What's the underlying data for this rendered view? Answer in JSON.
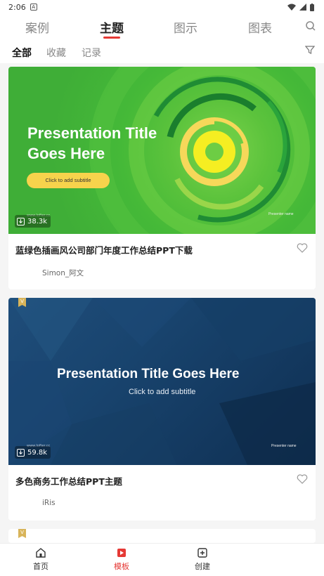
{
  "status": {
    "time": "2:06"
  },
  "top_tabs": [
    {
      "label": "案例"
    },
    {
      "label": "主题"
    },
    {
      "label": "图示"
    },
    {
      "label": "图表"
    }
  ],
  "sub_tabs": [
    {
      "label": "全部"
    },
    {
      "label": "收藏"
    },
    {
      "label": "记录"
    }
  ],
  "cards": [
    {
      "slide_title_line1": "Presentation Title",
      "slide_title_line2": "Goes Here",
      "slide_button": "Click to add subtitle",
      "presenter": "Presenter name",
      "watermark": "www.lofter.cc",
      "downloads": "38.3k",
      "title": "蓝绿色插画风公司部门年度工作总结PPT下载",
      "author": "Simon_阿文",
      "accent": "#45b938"
    },
    {
      "slide_title": "Presentation Title Goes Here",
      "slide_subtitle": "Click to add subtitle",
      "presenter": "Presenter name",
      "watermark": "www.lofter.cc",
      "downloads": "59.8k",
      "title": "多色商务工作总结PPT主题",
      "author": "iRis",
      "accent": "#18436d",
      "vip_label": "V"
    }
  ],
  "third_card": {
    "vip_label": "V"
  },
  "tabbar": [
    {
      "label": "首页",
      "icon": "home-icon"
    },
    {
      "label": "模板",
      "icon": "template-icon"
    },
    {
      "label": "创建",
      "icon": "create-icon"
    }
  ],
  "colors": {
    "accent": "#e53935"
  }
}
